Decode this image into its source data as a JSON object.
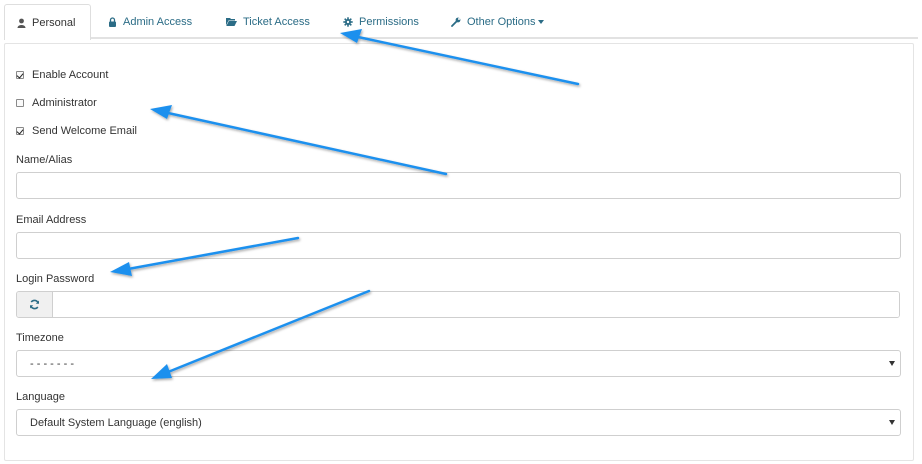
{
  "tabs": [
    {
      "label": "Personal",
      "icon": "user-icon",
      "active": true
    },
    {
      "label": "Admin Access",
      "icon": "lock-icon",
      "active": false
    },
    {
      "label": "Ticket Access",
      "icon": "folder-open-icon",
      "active": false
    },
    {
      "label": "Permissions",
      "icon": "gear-icon",
      "active": false
    },
    {
      "label": "Other Options",
      "icon": "wrench-icon",
      "active": false,
      "dropdown": true
    }
  ],
  "checkboxes": [
    {
      "label": "Enable Account",
      "checked": true
    },
    {
      "label": "Administrator",
      "checked": false
    },
    {
      "label": "Send Welcome Email",
      "checked": true
    }
  ],
  "fields": {
    "name_label": "Name/Alias",
    "name_value": "",
    "email_label": "Email Address",
    "email_value": "",
    "password_label": "Login Password",
    "password_addon_icon": "refresh-icon",
    "password_value": "",
    "timezone_label": "Timezone",
    "timezone_value": "- - - - - - -",
    "language_label": "Language",
    "language_value": "Default System Language (english)"
  },
  "colors": {
    "link": "#2b6c86",
    "annotation_arrow": "#1e90ee",
    "border": "#cfcfcf"
  }
}
